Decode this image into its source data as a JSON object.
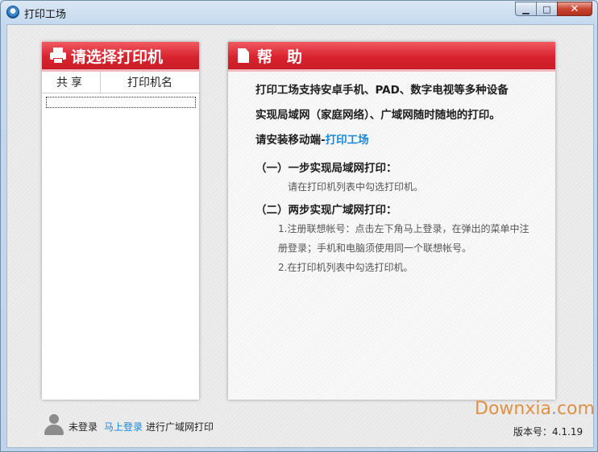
{
  "window": {
    "title": "打印工场",
    "controls": {
      "minimize": "▁",
      "maximize": "□",
      "close": "✕"
    }
  },
  "printer_panel": {
    "title": "请选择打印机",
    "icon": "printer-icon",
    "columns": [
      "共享",
      "打印机名"
    ],
    "printers": []
  },
  "help_panel": {
    "title": "帮助",
    "icon": "document-icon",
    "intro_line1": "打印工场支持安卓手机、PAD、数字电视等多种设备",
    "intro_line2": "实现局域网（家庭网络）、广域网随时随地的打印。",
    "install_prefix": "请安装移动端-",
    "install_link": "打印工场",
    "step1_title": "（一）一步实现局域网打印：",
    "step1_desc": "请在打印机列表中勾选打印机。",
    "step2_title": "（二）两步实现广域网打印：",
    "step2_desc1": "1.注册联想帐号：点击左下角马上登录，在弹出的菜单中注",
    "step2_desc2": "册登录；手机和电脑须使用同一个联想帐号。",
    "step2_desc3": "2.在打印机列表中勾选打印机。"
  },
  "footer": {
    "status": "未登录",
    "login_link": "马上登录",
    "login_suffix": "进行广域网打印",
    "version_label": "版本号：4.1.19"
  },
  "watermark": {
    "text_main": "Downxia",
    "text_dot": ".",
    "text_tld": "com"
  },
  "colors": {
    "header_red": "#d9232f",
    "link_blue": "#1a86d6"
  }
}
